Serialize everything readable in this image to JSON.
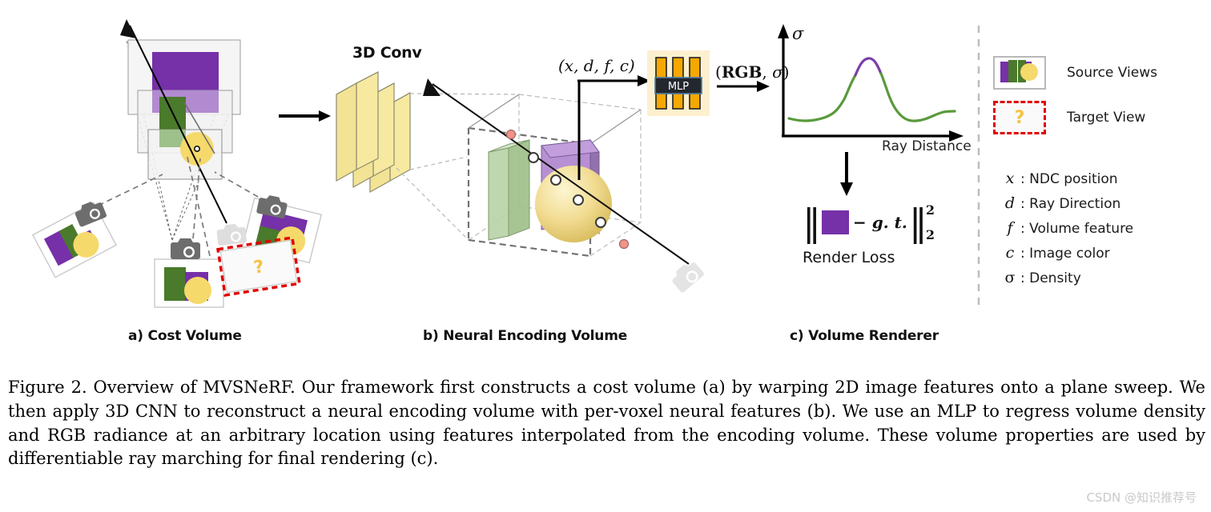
{
  "figure": {
    "panels": [
      {
        "id": "a",
        "label": "a) Cost Volume"
      },
      {
        "id": "b",
        "label": "b) Neural Encoding Volume"
      },
      {
        "id": "c",
        "label": "c) Volume Renderer"
      }
    ],
    "conv_title": "3D Conv",
    "mlp_label": "MLP",
    "input_tuple": "(x, d, f, c)",
    "output_tuple_prefix": "(",
    "output_tuple_rgb": "RGB",
    "output_tuple_comma": ", ",
    "output_tuple_sigma": "σ",
    "output_tuple_suffix": ")",
    "sigma_axis_label": "σ",
    "x_axis_label": "Ray Distance",
    "render_loss_label": "Render Loss",
    "loss_minus_gt": "− g. t.",
    "loss_exponent": "2",
    "loss_subscript": "2",
    "question_mark": "?"
  },
  "legend": {
    "source_views_label": "Source Views",
    "target_view_label": "Target View",
    "target_marker": "?",
    "symbols": [
      {
        "glyph": "x",
        "desc": ": NDC position",
        "italic": true
      },
      {
        "glyph": "d",
        "desc": ": Ray Direction",
        "italic": true
      },
      {
        "glyph": "f",
        "desc": ": Volume feature",
        "italic": true
      },
      {
        "glyph": "c",
        "desc": ": Image color",
        "italic": true
      },
      {
        "glyph": "σ",
        "desc": ": Density",
        "italic": false
      }
    ]
  },
  "caption": {
    "text": "Figure 2. Overview of MVSNeRF. Our framework first constructs a cost volume (a) by warping 2D image features onto a plane sweep. We then apply 3D CNN to reconstruct a neural encoding volume with per-voxel neural features (b). We use an MLP to regress volume density and RGB radiance at an arbitrary location using features interpolated from the encoding volume. These volume properties are used by differentiable ray marching for final rendering (c)."
  },
  "watermark": {
    "text": "CSDN @知识推荐号"
  },
  "colors": {
    "purple": "#7630a8",
    "purple_light": "#b28ad0",
    "green": "#4a7a2b",
    "green_light": "#9ec08a",
    "yellow": "#f5d96b",
    "yellow_deep": "#f2ca3c",
    "orange": "#f5a800",
    "cream": "#fdf0cf",
    "slab": "#f7e9a0",
    "gray_cam": "#6d6d6d",
    "gray_cam_faint": "#e2e2e2",
    "red_dash": "#e00000",
    "curve_green": "#5a9a3c",
    "curve_purple": "#7b3fa8",
    "pink_point": "#f0938a",
    "divider": "#bdbdbd"
  }
}
